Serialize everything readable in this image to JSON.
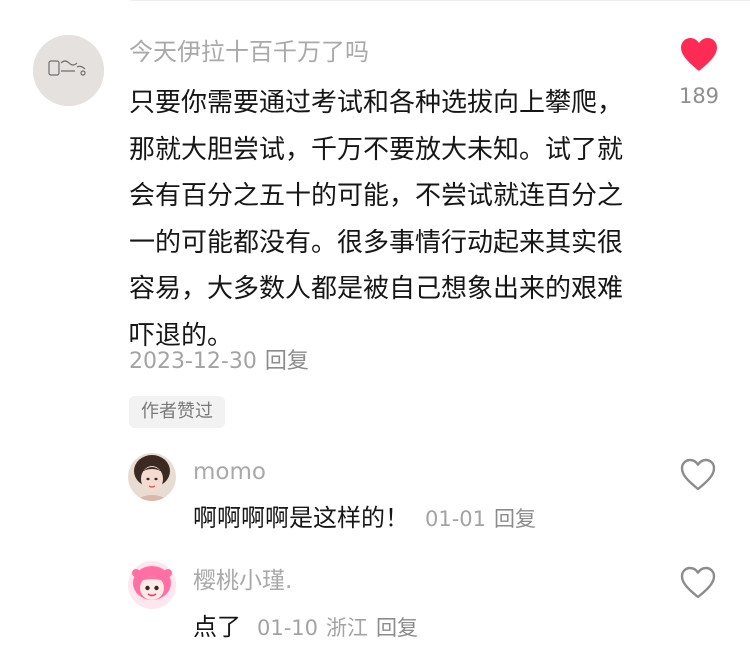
{
  "main_comment": {
    "username": "今天伊拉十百千万了吗",
    "text": "只要你需要通过考试和各种选拔向上攀爬，那就大胆尝试，千万不要放大未知。试了就会有百分之五十的可能，不尝试就连百分之一的可能都没有。很多事情行动起来其实很容易，大多数人都是被自己想象出来的艰难吓退的。",
    "date": "2023-12-30",
    "reply_label": "回复",
    "author_liked_badge": "作者赞过",
    "like_count": "189",
    "liked": true,
    "like_color": "#fe2c55"
  },
  "replies": [
    {
      "username": "momo",
      "text": "啊啊啊啊是这样的！",
      "date": "01-01",
      "location": "",
      "reply_label": "回复"
    },
    {
      "username": "樱桃小瑾.",
      "text": "点了",
      "date": "01-10",
      "location": "浙江",
      "reply_label": "回复"
    }
  ],
  "icons": {
    "like_filled": "heart-filled-icon",
    "like_outline": "heart-outline-icon"
  }
}
